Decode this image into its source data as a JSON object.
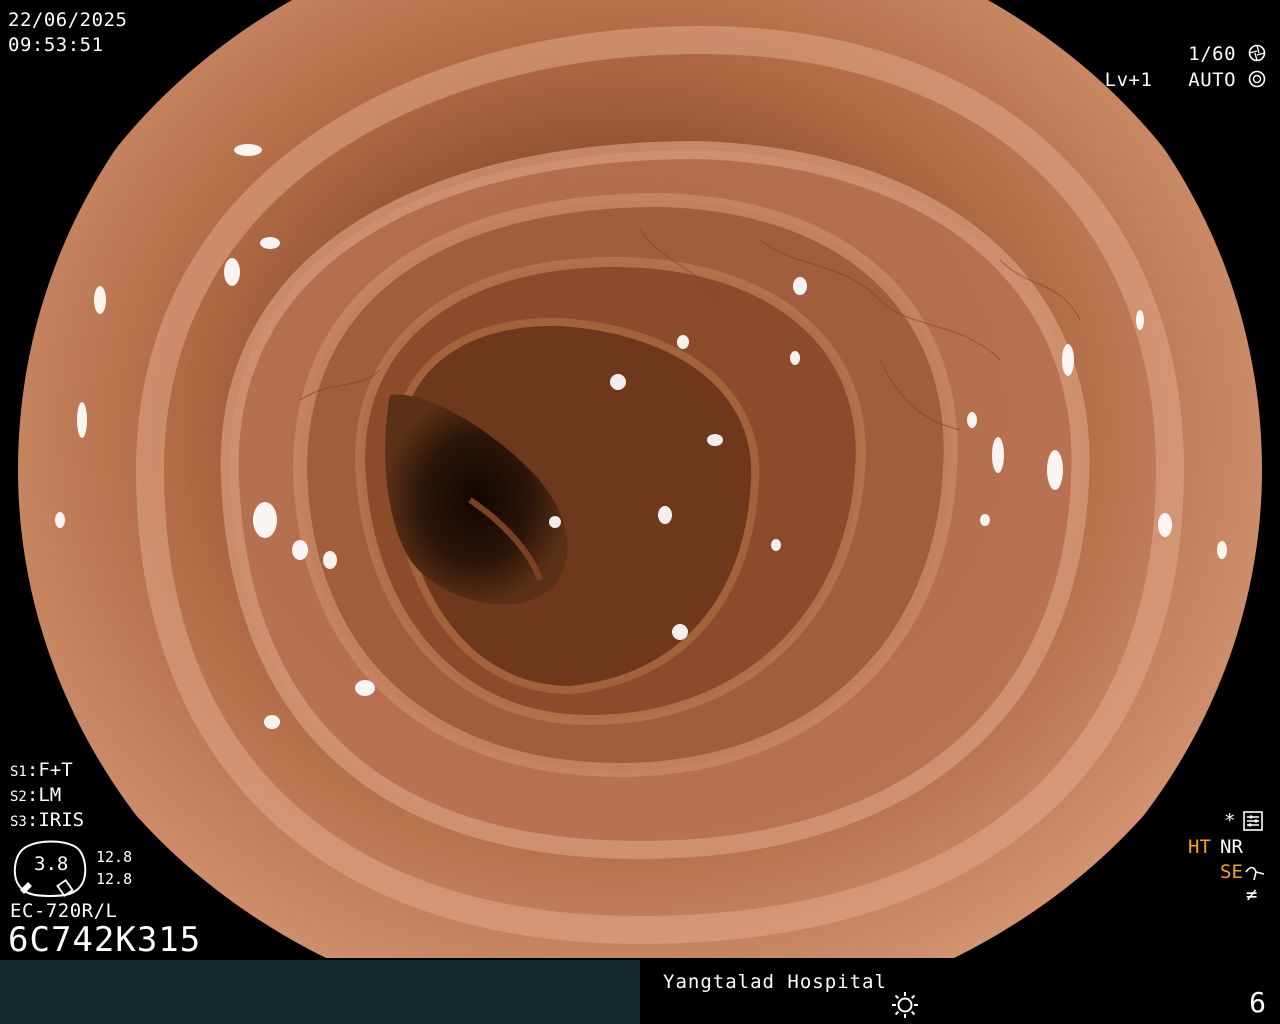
{
  "overlay": {
    "date": "22/06/2025",
    "time": "09:53:51",
    "shutter": "1/60",
    "level": "Lv+1",
    "auto": "AUTO",
    "settings": [
      {
        "key": "S1",
        "value": "F+T"
      },
      {
        "key": "S2",
        "value": "LM"
      },
      {
        "key": "S3",
        "value": "IRIS"
      }
    ],
    "gauge": {
      "value": "3.8",
      "readout_top": "12.8",
      "readout_bottom": "12.8"
    },
    "scope_model": "EC-720R/L",
    "serial": "6C742K315",
    "indicators": {
      "star": "*",
      "ht": "HT",
      "nr": "NR",
      "se": "SE",
      "not_equal": "≠"
    }
  },
  "footer": {
    "hospital": "Yangtalad Hospital",
    "frame_number": "6",
    "brightness_icon": "sun-icon"
  },
  "colors": {
    "tissue_outer": "#c98a68",
    "tissue_mid": "#a9623e",
    "tissue_deep": "#5a2e16",
    "lumen_dark": "#1e0e06",
    "footer_left_bg": "#142a2a",
    "indicator_orange": "#f7a21b"
  },
  "icons": [
    "shutter-icon",
    "auto-iris-icon",
    "enhancement-menu-icon",
    "structure-enhancement-icon",
    "sun-icon"
  ]
}
